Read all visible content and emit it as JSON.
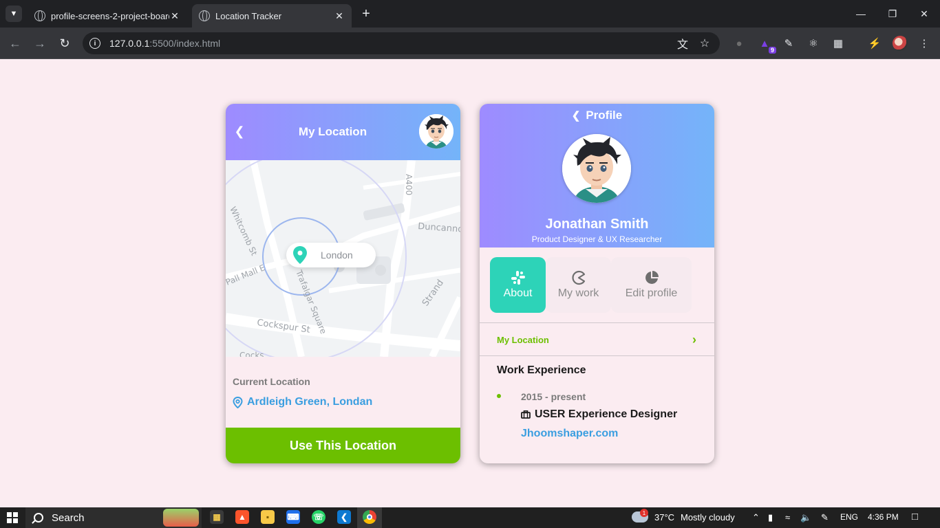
{
  "browser": {
    "tabs": [
      {
        "title": "profile-screens-2-project-board",
        "active": false
      },
      {
        "title": "Location Tracker",
        "active": true
      }
    ],
    "url_host": "127.0.0.1",
    "url_rest": ":5500/index.html",
    "extension_badge": "9"
  },
  "location_card": {
    "title": "My Location",
    "map": {
      "pin_label": "London",
      "streets": [
        "A400",
        "Whitcomb St",
        "Duncanno",
        "Pall Mall E",
        "Trafalgar Square",
        "Cockspur St",
        "Strand",
        "Cocks"
      ]
    },
    "current_location_label": "Current Location",
    "current_location_value": "Ardleigh Green, Londan",
    "action_button": "Use This Location",
    "colors": {
      "header_start": "#9e8bff",
      "header_end": "#74b4f9",
      "action": "#6cbf00",
      "link": "#3a9ee0"
    }
  },
  "profile_card": {
    "heading": "Profile",
    "name": "Jonathan Smith",
    "role": "Product Designer & UX Researcher",
    "tabs": [
      {
        "label": "About",
        "icon": "slack-icon",
        "active": true
      },
      {
        "label": "My work",
        "icon": "pacman-icon",
        "active": false
      },
      {
        "label": "Edit profile",
        "icon": "pie-chart-icon",
        "active": false
      }
    ],
    "my_location_link": "My Location",
    "work_experience": {
      "title": "Work Experience",
      "period": "2015 - present",
      "job_title": "USER Experience Designer",
      "company": "Jhoomshaper.com"
    },
    "colors": {
      "active_tab": "#2dd3b8",
      "accent": "#6cbf00"
    }
  },
  "taskbar": {
    "search_placeholder": "Search",
    "weather_temp": "37°C",
    "weather_desc": "Mostly cloudy",
    "weather_alert_count": "1",
    "language": "ENG",
    "time": "4:36 PM"
  }
}
